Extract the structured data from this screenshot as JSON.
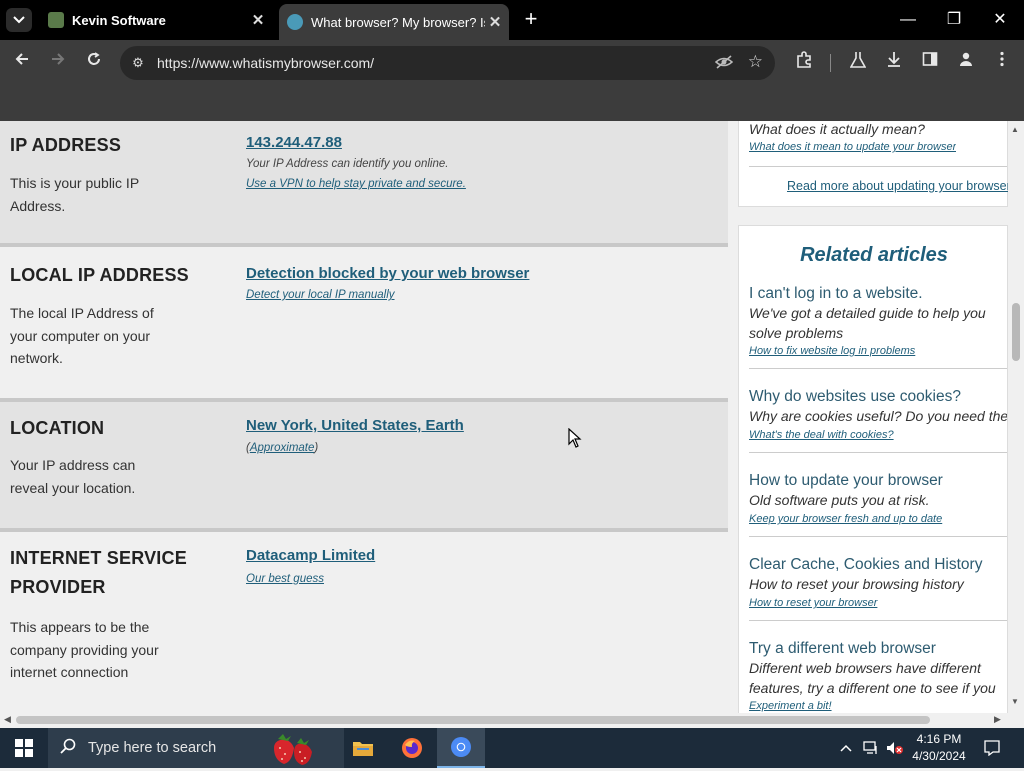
{
  "browser": {
    "tabs": [
      {
        "title": "Kevin Software",
        "active": false
      },
      {
        "title": "What browser? My browser? Is",
        "active": true
      }
    ],
    "url": "https://www.whatismybrowser.com/"
  },
  "sections": {
    "ip": {
      "label": "IP ADDRESS",
      "desc": "This is your public IP Address.",
      "value": "143.244.47.88",
      "sub": "Your IP Address can identify you online.",
      "sublink": "Use a VPN to help stay private and secure."
    },
    "local": {
      "label": "LOCAL IP ADDRESS",
      "desc": "The local IP Address of your computer on your network.",
      "value": "Detection blocked by your web browser",
      "sublink": "Detect your local IP manually"
    },
    "location": {
      "label": "LOCATION",
      "desc": "Your IP address can reveal your location.",
      "value": "New York, United States, Earth",
      "sub_prefix": "(",
      "sublink": "Approximate",
      "sub_suffix": ")"
    },
    "isp": {
      "label_line1": "INTERNET SERVICE",
      "label_line2": "PROVIDER",
      "desc": "This appears to be the company providing your internet connection",
      "value": "Datacamp Limited",
      "sublink": "Our best guess"
    }
  },
  "sidebar": {
    "top_card": {
      "question": "What does it actually mean?",
      "link": "What does it mean to update your browser",
      "read_more": "Read more about updating your browser"
    },
    "related_title": "Related articles",
    "articles": [
      {
        "title": "I can't log in to a website.",
        "desc": "We've got a detailed guide to help you solve problems",
        "link": "How to fix website log in problems"
      },
      {
        "title": "Why do websites use cookies?",
        "desc": "Why are cookies useful? Do you need them?",
        "link": "What's the deal with cookies?"
      },
      {
        "title": "How to update your browser",
        "desc": "Old software puts you at risk.",
        "link": "Keep your browser fresh and up to date"
      },
      {
        "title": "Clear Cache, Cookies and History",
        "desc": "How to reset your browsing history",
        "link": "How to reset your browser"
      },
      {
        "title": "Try a different web browser",
        "desc": "Different web browsers have different features, try a different one to see if you prefer it.",
        "link": "Experiment a bit!"
      }
    ]
  },
  "taskbar": {
    "search_placeholder": "Type here to search",
    "time": "4:16 PM",
    "date": "4/30/2024"
  },
  "colors": {
    "link": "#1f5e7a",
    "taskbar": "#1c2b3a",
    "chrome_dark": "#3c3c3c"
  }
}
